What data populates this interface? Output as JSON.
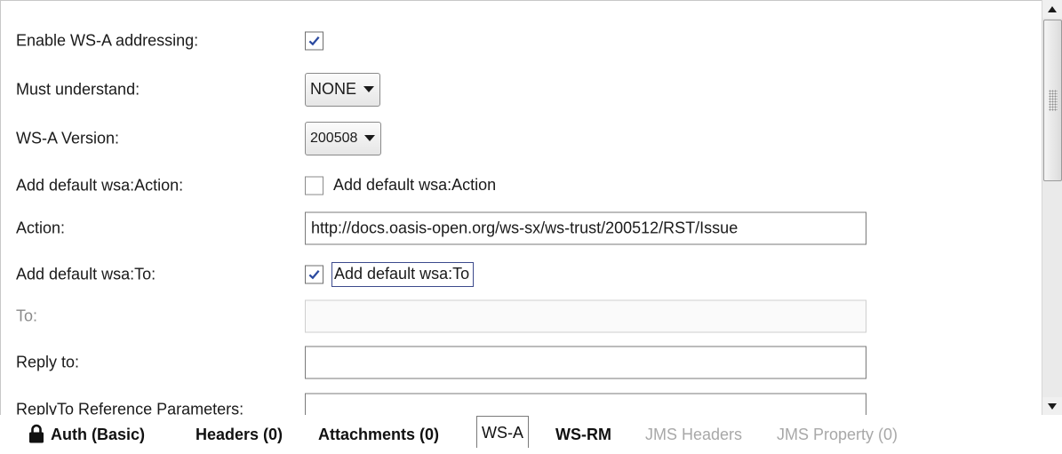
{
  "form": {
    "enable_ws_a": {
      "label": "Enable WS-A addressing:",
      "checked": true
    },
    "must_understand": {
      "label": "Must understand:",
      "value": "NONE"
    },
    "ws_a_version": {
      "label": "WS-A Version:",
      "value": "200508"
    },
    "add_default_action": {
      "label": "Add default wsa:Action:",
      "checkbox_label": "Add default wsa:Action",
      "checked": false
    },
    "action": {
      "label": "Action:",
      "value": "http://docs.oasis-open.org/ws-sx/ws-trust/200512/RST/Issue"
    },
    "add_default_to": {
      "label": "Add default wsa:To:",
      "checkbox_label": "Add default wsa:To",
      "checked": true
    },
    "to": {
      "label": "To:",
      "value": "",
      "disabled": true
    },
    "reply_to": {
      "label": "Reply to:",
      "value": ""
    },
    "reply_to_params": {
      "label": "ReplyTo Reference Parameters:",
      "value": ""
    }
  },
  "tabs": [
    {
      "label": "Auth (Basic)",
      "icon": "lock-icon",
      "state": "normal"
    },
    {
      "label": "Headers (0)",
      "state": "normal"
    },
    {
      "label": "Attachments (0)",
      "state": "normal"
    },
    {
      "label": "WS-A",
      "state": "selected"
    },
    {
      "label": "WS-RM",
      "state": "normal"
    },
    {
      "label": "JMS Headers",
      "state": "disabled"
    },
    {
      "label": "JMS Property (0)",
      "state": "disabled"
    }
  ],
  "colors": {
    "check_mark": "#2b4aa0",
    "disabled_text": "#a8a8a8"
  }
}
